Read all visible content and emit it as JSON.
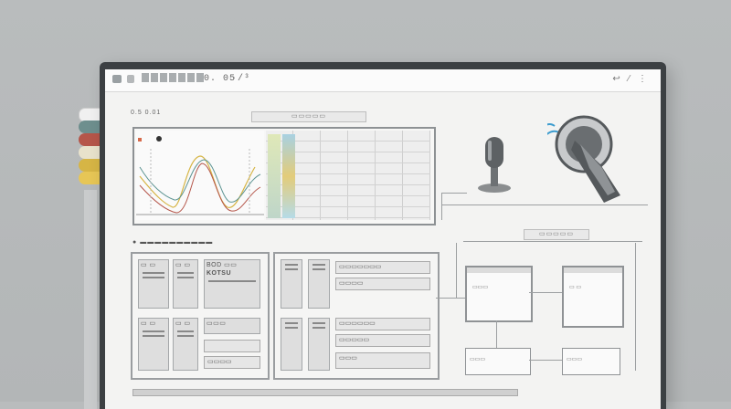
{
  "toolbar": {
    "address_text": "0. 05",
    "address_suffix": "·/³",
    "right_icons": "↩ ⁄ ⋮"
  },
  "panels": {
    "top_label": "0.5 0.01",
    "chart_title": "▭▭▭▭▭",
    "dropdown_label": "▭▭▭▭▭",
    "section_label": "▬▬▬▬▬▬▬▬▬▬"
  },
  "left_form": {
    "box1": "▭ ▭",
    "box2": "▭ ▭",
    "box3_title": "BOD ▭▭",
    "box3_value": "KOTSU",
    "box4": "▭ ▭",
    "box5": "▭ ▭",
    "box6": "▭▭▭",
    "field_bottom": "▭▭▭▭"
  },
  "right_form": {
    "field1": "▭▭▭▭▭▭▭",
    "field2": "▭▭▭▭",
    "field3": "▭▭▭▭▭▭",
    "field4": "▭▭▭▭▭",
    "field5": "▭▭▭"
  },
  "diagram": {
    "label_a": "▭▭▭",
    "label_b": "▭ ▭",
    "label_c": "▭▭▭",
    "label_d": "▭▭▭"
  },
  "colors": {
    "binder_red": "#b5564a",
    "binder_yellow": "#d6b545",
    "binder_teal": "#5e9593",
    "accent_blue": "#3d9ccf"
  }
}
